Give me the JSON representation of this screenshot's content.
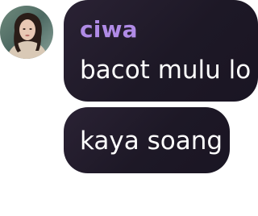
{
  "chat": {
    "sender": {
      "name": "ciwa",
      "avatar_icon": "user-avatar",
      "name_color": "#b08be6"
    },
    "messages": [
      {
        "text": "bacot mulu lo"
      },
      {
        "text": "kaya soang"
      }
    ],
    "bubble_color": "#211b2b",
    "text_color": "#ffffff"
  }
}
